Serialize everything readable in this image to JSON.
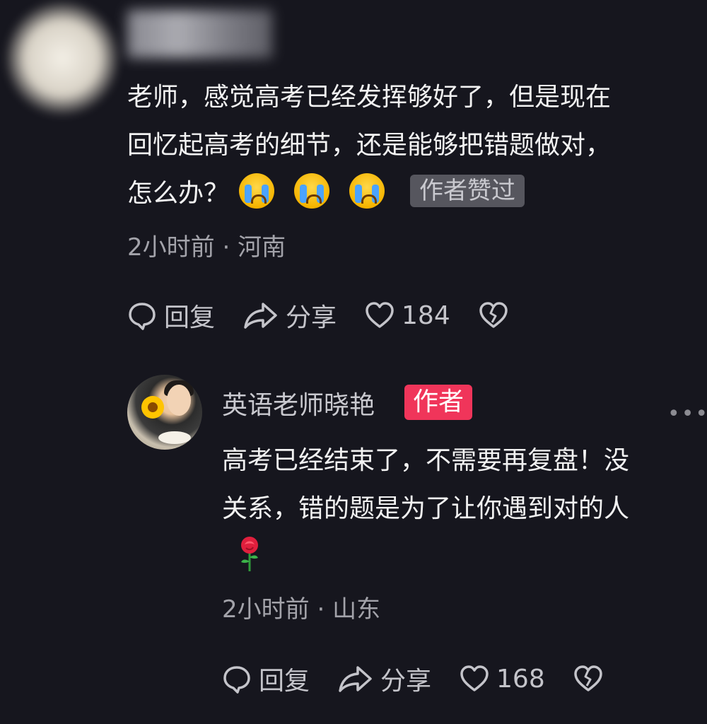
{
  "comment1": {
    "text_line1": "老师，感觉高考已经发挥够好了，但是现在",
    "text_line2": "回忆起高考的细节，还是能够把错题做对，",
    "text_line3": "怎么办？",
    "emoji_icons": [
      "loudly-crying-face-icon",
      "loudly-crying-face-icon",
      "loudly-crying-face-icon"
    ],
    "liked_badge": "作者赞过",
    "time": "2小时前",
    "location": "河南",
    "reply_label": "回复",
    "share_label": "分享",
    "like_count": "184"
  },
  "reply": {
    "author_name": "英语老师晓艳",
    "author_badge": "作者",
    "text_line1": "高考已经结束了，不需要再复盘！没",
    "text_line2": "关系，错的题是为了让你遇到对的人",
    "emoji_icon": "rose-icon",
    "time": "2小时前",
    "location": "山东",
    "reply_label": "回复",
    "share_label": "分享",
    "like_count": "168",
    "more_icon": "more-dots-icon"
  },
  "colors": {
    "background": "#16161e",
    "author_badge": "#f0355a",
    "liked_badge_bg": "#56565e",
    "meta_text": "#a3a3aa"
  },
  "meta_separator": "·"
}
